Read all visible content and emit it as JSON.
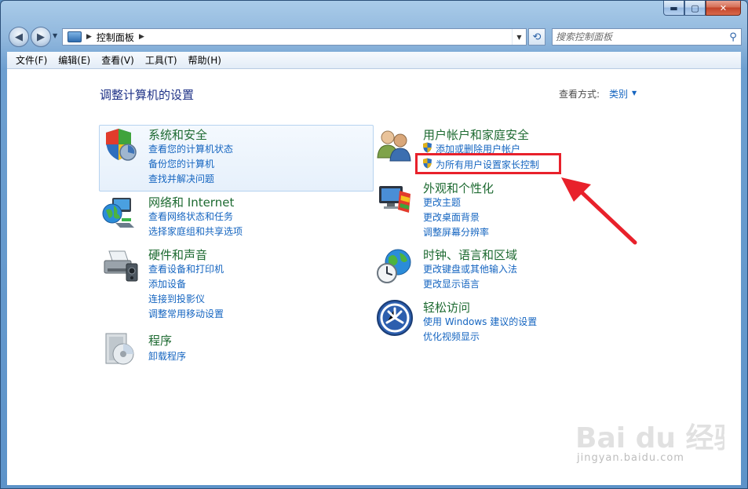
{
  "window": {
    "caption_minimize": "▬",
    "caption_maximize": "▢",
    "caption_close": "✕"
  },
  "navbar": {
    "address_text": "控制面板",
    "search_placeholder": "搜索控制面板"
  },
  "menubar": {
    "items": [
      "文件(F)",
      "编辑(E)",
      "查看(V)",
      "工具(T)",
      "帮助(H)"
    ]
  },
  "content": {
    "title": "调整计算机的设置",
    "view_mode_label": "查看方式:",
    "view_mode_value": "类别",
    "categories": [
      {
        "title": "系统和安全",
        "links": [
          "查看您的计算机状态",
          "备份您的计算机",
          "查找并解决问题"
        ]
      },
      {
        "title": "网络和 Internet",
        "links": [
          "查看网络状态和任务",
          "选择家庭组和共享选项"
        ]
      },
      {
        "title": "硬件和声音",
        "links": [
          "查看设备和打印机",
          "添加设备",
          "连接到投影仪",
          "调整常用移动设置"
        ]
      },
      {
        "title": "程序",
        "links": [
          "卸载程序"
        ]
      },
      {
        "title": "用户帐户和家庭安全",
        "links": [
          "添加或删除用户帐户",
          "为所有用户设置家长控制"
        ]
      },
      {
        "title": "外观和个性化",
        "links": [
          "更改主题",
          "更改桌面背景",
          "调整屏幕分辨率"
        ]
      },
      {
        "title": "时钟、语言和区域",
        "links": [
          "更改键盘或其他输入法",
          "更改显示语言"
        ]
      },
      {
        "title": "轻松访问",
        "links": [
          "使用 Windows 建议的设置",
          "优化视频显示"
        ]
      }
    ]
  },
  "watermark": {
    "brand": "Bai du 经验",
    "url": "jingyan.baidu.com"
  },
  "colors": {
    "category_title": "#1d6a31",
    "link": "#1565c0",
    "page_title": "#1e3287",
    "annotation_red": "#e8212b"
  }
}
